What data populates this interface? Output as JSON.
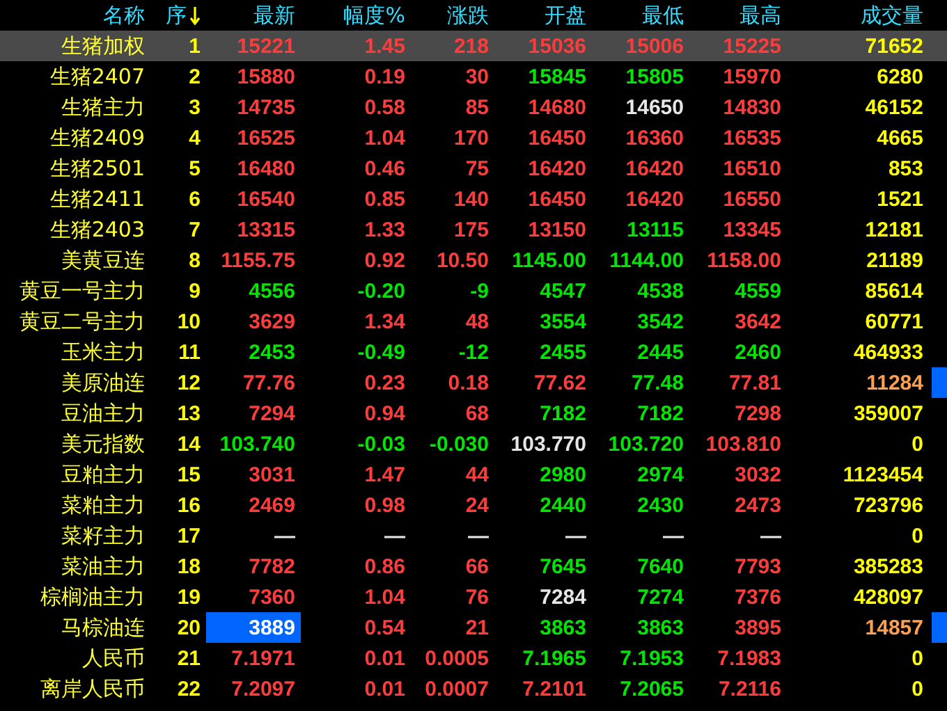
{
  "columns": [
    {
      "label": "名称",
      "sorted": false
    },
    {
      "label": "序",
      "sorted": true
    },
    {
      "label": "最新",
      "sorted": false
    },
    {
      "label": "幅度%",
      "sorted": false
    },
    {
      "label": "涨跌",
      "sorted": false
    },
    {
      "label": "开盘",
      "sorted": false
    },
    {
      "label": "最低",
      "sorted": false
    },
    {
      "label": "最高",
      "sorted": false
    },
    {
      "label": "成交量",
      "sorted": false
    }
  ],
  "rows": [
    {
      "name": "生猪加权",
      "seq": "1",
      "selected": true,
      "latest_flash": false,
      "volume_flash": false,
      "cells": [
        {
          "text": "15221",
          "color": "#ff3c3c"
        },
        {
          "text": "1.45",
          "color": "#ff3c3c"
        },
        {
          "text": "218",
          "color": "#ff3c3c"
        },
        {
          "text": "15036",
          "color": "#ff3c3c"
        },
        {
          "text": "15006",
          "color": "#ff3c3c"
        },
        {
          "text": "15225",
          "color": "#ff3c3c"
        }
      ],
      "volume": "71652"
    },
    {
      "name": "生猪2407",
      "seq": "2",
      "selected": false,
      "latest_flash": false,
      "volume_flash": false,
      "cells": [
        {
          "text": "15880",
          "color": "#ff3c3c"
        },
        {
          "text": "0.19",
          "color": "#ff3c3c"
        },
        {
          "text": "30",
          "color": "#ff3c3c"
        },
        {
          "text": "15845",
          "color": "#00e600"
        },
        {
          "text": "15805",
          "color": "#00e600"
        },
        {
          "text": "15970",
          "color": "#ff3c3c"
        }
      ],
      "volume": "6280"
    },
    {
      "name": "生猪主力",
      "seq": "3",
      "selected": false,
      "latest_flash": false,
      "volume_flash": false,
      "cells": [
        {
          "text": "14735",
          "color": "#ff3c3c"
        },
        {
          "text": "0.58",
          "color": "#ff3c3c"
        },
        {
          "text": "85",
          "color": "#ff3c3c"
        },
        {
          "text": "14680",
          "color": "#ff3c3c"
        },
        {
          "text": "14650",
          "color": "#e6e6e6"
        },
        {
          "text": "14830",
          "color": "#ff3c3c"
        }
      ],
      "volume": "46152"
    },
    {
      "name": "生猪2409",
      "seq": "4",
      "selected": false,
      "latest_flash": false,
      "volume_flash": false,
      "cells": [
        {
          "text": "16525",
          "color": "#ff3c3c"
        },
        {
          "text": "1.04",
          "color": "#ff3c3c"
        },
        {
          "text": "170",
          "color": "#ff3c3c"
        },
        {
          "text": "16450",
          "color": "#ff3c3c"
        },
        {
          "text": "16360",
          "color": "#ff3c3c"
        },
        {
          "text": "16535",
          "color": "#ff3c3c"
        }
      ],
      "volume": "4665"
    },
    {
      "name": "生猪2501",
      "seq": "5",
      "selected": false,
      "latest_flash": false,
      "volume_flash": false,
      "cells": [
        {
          "text": "16480",
          "color": "#ff3c3c"
        },
        {
          "text": "0.46",
          "color": "#ff3c3c"
        },
        {
          "text": "75",
          "color": "#ff3c3c"
        },
        {
          "text": "16420",
          "color": "#ff3c3c"
        },
        {
          "text": "16420",
          "color": "#ff3c3c"
        },
        {
          "text": "16510",
          "color": "#ff3c3c"
        }
      ],
      "volume": "853"
    },
    {
      "name": "生猪2411",
      "seq": "6",
      "selected": false,
      "latest_flash": false,
      "volume_flash": false,
      "cells": [
        {
          "text": "16540",
          "color": "#ff3c3c"
        },
        {
          "text": "0.85",
          "color": "#ff3c3c"
        },
        {
          "text": "140",
          "color": "#ff3c3c"
        },
        {
          "text": "16450",
          "color": "#ff3c3c"
        },
        {
          "text": "16420",
          "color": "#ff3c3c"
        },
        {
          "text": "16550",
          "color": "#ff3c3c"
        }
      ],
      "volume": "1521"
    },
    {
      "name": "生猪2403",
      "seq": "7",
      "selected": false,
      "latest_flash": false,
      "volume_flash": false,
      "cells": [
        {
          "text": "13315",
          "color": "#ff3c3c"
        },
        {
          "text": "1.33",
          "color": "#ff3c3c"
        },
        {
          "text": "175",
          "color": "#ff3c3c"
        },
        {
          "text": "13150",
          "color": "#ff3c3c"
        },
        {
          "text": "13115",
          "color": "#00e600"
        },
        {
          "text": "13345",
          "color": "#ff3c3c"
        }
      ],
      "volume": "12181"
    },
    {
      "name": "美黄豆连",
      "seq": "8",
      "selected": false,
      "latest_flash": false,
      "volume_flash": false,
      "cells": [
        {
          "text": "1155.75",
          "color": "#ff3c3c"
        },
        {
          "text": "0.92",
          "color": "#ff3c3c"
        },
        {
          "text": "10.50",
          "color": "#ff3c3c"
        },
        {
          "text": "1145.00",
          "color": "#00e600"
        },
        {
          "text": "1144.00",
          "color": "#00e600"
        },
        {
          "text": "1158.00",
          "color": "#ff3c3c"
        }
      ],
      "volume": "21189"
    },
    {
      "name": "黄豆一号主力",
      "seq": "9",
      "selected": false,
      "latest_flash": false,
      "volume_flash": false,
      "cells": [
        {
          "text": "4556",
          "color": "#00e600"
        },
        {
          "text": "-0.20",
          "color": "#00e600"
        },
        {
          "text": "-9",
          "color": "#00e600"
        },
        {
          "text": "4547",
          "color": "#00e600"
        },
        {
          "text": "4538",
          "color": "#00e600"
        },
        {
          "text": "4559",
          "color": "#00e600"
        }
      ],
      "volume": "85614"
    },
    {
      "name": "黄豆二号主力",
      "seq": "10",
      "selected": false,
      "latest_flash": false,
      "volume_flash": false,
      "cells": [
        {
          "text": "3629",
          "color": "#ff3c3c"
        },
        {
          "text": "1.34",
          "color": "#ff3c3c"
        },
        {
          "text": "48",
          "color": "#ff3c3c"
        },
        {
          "text": "3554",
          "color": "#00e600"
        },
        {
          "text": "3542",
          "color": "#00e600"
        },
        {
          "text": "3642",
          "color": "#ff3c3c"
        }
      ],
      "volume": "60771"
    },
    {
      "name": "玉米主力",
      "seq": "11",
      "selected": false,
      "latest_flash": false,
      "volume_flash": false,
      "cells": [
        {
          "text": "2453",
          "color": "#00e600"
        },
        {
          "text": "-0.49",
          "color": "#00e600"
        },
        {
          "text": "-12",
          "color": "#00e600"
        },
        {
          "text": "2455",
          "color": "#00e600"
        },
        {
          "text": "2445",
          "color": "#00e600"
        },
        {
          "text": "2460",
          "color": "#00e600"
        }
      ],
      "volume": "464933"
    },
    {
      "name": "美原油连",
      "seq": "12",
      "selected": false,
      "latest_flash": false,
      "volume_flash": true,
      "cells": [
        {
          "text": "77.76",
          "color": "#ff3c3c"
        },
        {
          "text": "0.23",
          "color": "#ff3c3c"
        },
        {
          "text": "0.18",
          "color": "#ff3c3c"
        },
        {
          "text": "77.62",
          "color": "#ff3c3c"
        },
        {
          "text": "77.48",
          "color": "#00e600"
        },
        {
          "text": "77.81",
          "color": "#ff3c3c"
        }
      ],
      "volume": "11284"
    },
    {
      "name": "豆油主力",
      "seq": "13",
      "selected": false,
      "latest_flash": false,
      "volume_flash": false,
      "cells": [
        {
          "text": "7294",
          "color": "#ff3c3c"
        },
        {
          "text": "0.94",
          "color": "#ff3c3c"
        },
        {
          "text": "68",
          "color": "#ff3c3c"
        },
        {
          "text": "7182",
          "color": "#00e600"
        },
        {
          "text": "7182",
          "color": "#00e600"
        },
        {
          "text": "7298",
          "color": "#ff3c3c"
        }
      ],
      "volume": "359007"
    },
    {
      "name": "美元指数",
      "seq": "14",
      "selected": false,
      "latest_flash": false,
      "volume_flash": false,
      "cells": [
        {
          "text": "103.740",
          "color": "#00e600"
        },
        {
          "text": "-0.03",
          "color": "#00e600"
        },
        {
          "text": "-0.030",
          "color": "#00e600"
        },
        {
          "text": "103.770",
          "color": "#e6e6e6"
        },
        {
          "text": "103.720",
          "color": "#00e600"
        },
        {
          "text": "103.810",
          "color": "#ff3c3c"
        }
      ],
      "volume": "0"
    },
    {
      "name": "豆粕主力",
      "seq": "15",
      "selected": false,
      "latest_flash": false,
      "volume_flash": false,
      "cells": [
        {
          "text": "3031",
          "color": "#ff3c3c"
        },
        {
          "text": "1.47",
          "color": "#ff3c3c"
        },
        {
          "text": "44",
          "color": "#ff3c3c"
        },
        {
          "text": "2980",
          "color": "#00e600"
        },
        {
          "text": "2974",
          "color": "#00e600"
        },
        {
          "text": "3032",
          "color": "#ff3c3c"
        }
      ],
      "volume": "1123454"
    },
    {
      "name": "菜粕主力",
      "seq": "16",
      "selected": false,
      "latest_flash": false,
      "volume_flash": false,
      "cells": [
        {
          "text": "2469",
          "color": "#ff3c3c"
        },
        {
          "text": "0.98",
          "color": "#ff3c3c"
        },
        {
          "text": "24",
          "color": "#ff3c3c"
        },
        {
          "text": "2440",
          "color": "#00e600"
        },
        {
          "text": "2430",
          "color": "#00e600"
        },
        {
          "text": "2473",
          "color": "#ff3c3c"
        }
      ],
      "volume": "723796"
    },
    {
      "name": "菜籽主力",
      "seq": "17",
      "selected": false,
      "latest_flash": false,
      "volume_flash": false,
      "cells": [
        {
          "text": "—",
          "color": "#e6e6e6"
        },
        {
          "text": "—",
          "color": "#e6e6e6"
        },
        {
          "text": "—",
          "color": "#e6e6e6"
        },
        {
          "text": "—",
          "color": "#e6e6e6"
        },
        {
          "text": "—",
          "color": "#e6e6e6"
        },
        {
          "text": "—",
          "color": "#e6e6e6"
        }
      ],
      "volume": "0"
    },
    {
      "name": "菜油主力",
      "seq": "18",
      "selected": false,
      "latest_flash": false,
      "volume_flash": false,
      "cells": [
        {
          "text": "7782",
          "color": "#ff3c3c"
        },
        {
          "text": "0.86",
          "color": "#ff3c3c"
        },
        {
          "text": "66",
          "color": "#ff3c3c"
        },
        {
          "text": "7645",
          "color": "#00e600"
        },
        {
          "text": "7640",
          "color": "#00e600"
        },
        {
          "text": "7793",
          "color": "#ff3c3c"
        }
      ],
      "volume": "385283"
    },
    {
      "name": "棕榈油主力",
      "seq": "19",
      "selected": false,
      "latest_flash": false,
      "volume_flash": false,
      "cells": [
        {
          "text": "7360",
          "color": "#ff3c3c"
        },
        {
          "text": "1.04",
          "color": "#ff3c3c"
        },
        {
          "text": "76",
          "color": "#ff3c3c"
        },
        {
          "text": "7284",
          "color": "#e6e6e6"
        },
        {
          "text": "7274",
          "color": "#00e600"
        },
        {
          "text": "7376",
          "color": "#ff3c3c"
        }
      ],
      "volume": "428097"
    },
    {
      "name": "马棕油连",
      "seq": "20",
      "selected": false,
      "latest_flash": true,
      "volume_flash": true,
      "cells": [
        {
          "text": "3889",
          "color": "#ffffff"
        },
        {
          "text": "0.54",
          "color": "#ff3c3c"
        },
        {
          "text": "21",
          "color": "#ff3c3c"
        },
        {
          "text": "3863",
          "color": "#00e600"
        },
        {
          "text": "3863",
          "color": "#00e600"
        },
        {
          "text": "3895",
          "color": "#ff3c3c"
        }
      ],
      "volume": "14857"
    },
    {
      "name": "人民币",
      "seq": "21",
      "selected": false,
      "latest_flash": false,
      "volume_flash": false,
      "cells": [
        {
          "text": "7.1971",
          "color": "#ff3c3c"
        },
        {
          "text": "0.01",
          "color": "#ff3c3c"
        },
        {
          "text": "0.0005",
          "color": "#ff3c3c"
        },
        {
          "text": "7.1965",
          "color": "#00e600"
        },
        {
          "text": "7.1953",
          "color": "#00e600"
        },
        {
          "text": "7.1983",
          "color": "#ff3c3c"
        }
      ],
      "volume": "0"
    },
    {
      "name": "离岸人民币",
      "seq": "22",
      "selected": false,
      "latest_flash": false,
      "volume_flash": false,
      "cells": [
        {
          "text": "7.2097",
          "color": "#ff3c3c"
        },
        {
          "text": "0.01",
          "color": "#ff3c3c"
        },
        {
          "text": "0.0007",
          "color": "#ff3c3c"
        },
        {
          "text": "7.2101",
          "color": "#ff3c3c"
        },
        {
          "text": "7.2065",
          "color": "#00e600"
        },
        {
          "text": "7.2116",
          "color": "#ff3c3c"
        }
      ],
      "volume": "0"
    }
  ]
}
